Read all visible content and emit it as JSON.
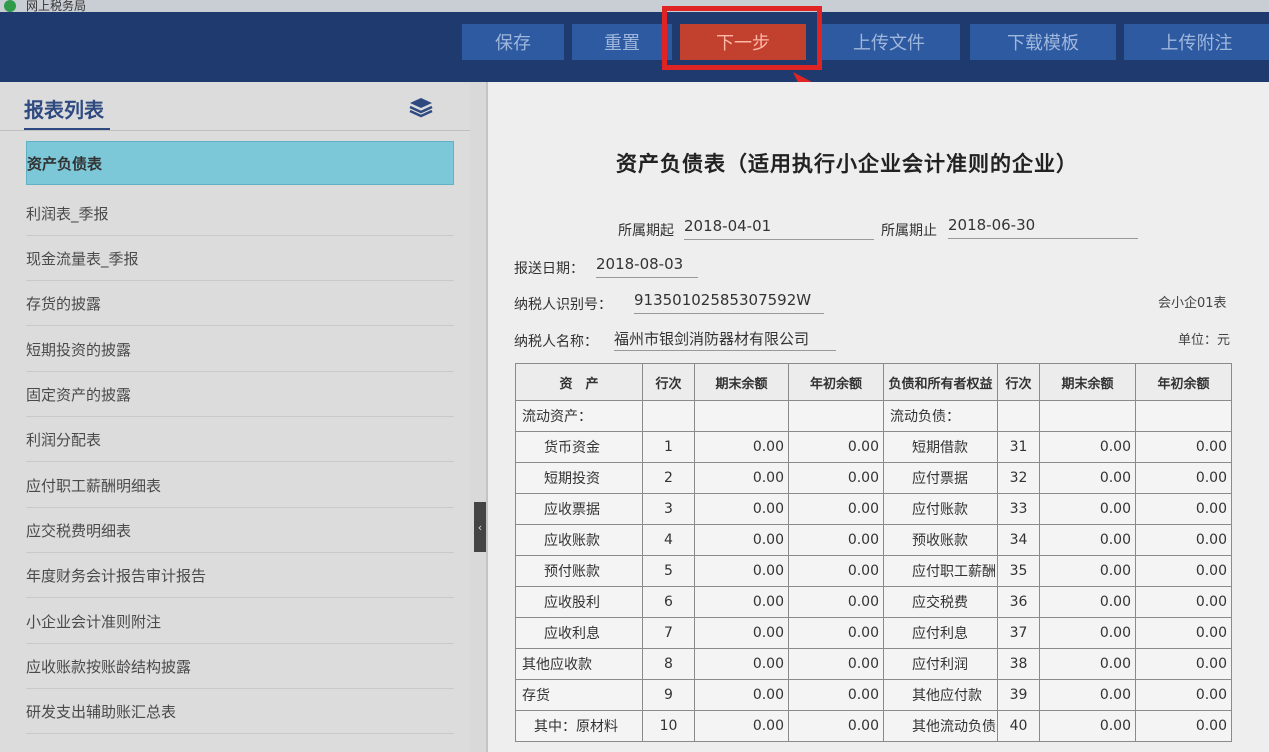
{
  "window": {
    "title": "网上税务局"
  },
  "toolbar": {
    "buttons": [
      {
        "label": "保存"
      },
      {
        "label": "重置"
      },
      {
        "label": "下一步"
      },
      {
        "label": "上传文件"
      },
      {
        "label": "下载模板"
      },
      {
        "label": "上传附注"
      }
    ]
  },
  "sidebar": {
    "title": "报表列表",
    "items": [
      {
        "label": "资产负债表"
      },
      {
        "label": "利润表_季报"
      },
      {
        "label": "现金流量表_季报"
      },
      {
        "label": "存货的披露"
      },
      {
        "label": "短期投资的披露"
      },
      {
        "label": "固定资产的披露"
      },
      {
        "label": "利润分配表"
      },
      {
        "label": "应付职工薪酬明细表"
      },
      {
        "label": "应交税费明细表"
      },
      {
        "label": "年度财务会计报告审计报告"
      },
      {
        "label": "小企业会计准则附注"
      },
      {
        "label": "应收账款按账龄结构披露"
      },
      {
        "label": "研发支出辅助账汇总表"
      }
    ]
  },
  "form": {
    "title": "资产负债表（适用执行小企业会计准则的企业）",
    "period_start_label": "所属期起",
    "period_start": "2018-04-01",
    "period_end_label": "所属期止",
    "period_end": "2018-06-30",
    "report_date_label": "报送日期：",
    "report_date": "2018-08-03",
    "taxpayer_id_label": "纳税人识别号：",
    "taxpayer_id": "91350102585307592W",
    "taxpayer_name_label": "纳税人名称：",
    "taxpayer_name": "福州市银剑消防器材有限公司",
    "form_code": "会小企01表",
    "unit": "单位：元"
  },
  "table": {
    "headers": {
      "asset": "资　产",
      "row_no": "行次",
      "end_balance": "期末余额",
      "begin_balance": "年初余额",
      "liability": "负债和所有者权益",
      "row_no_2": "行次",
      "end_balance_2": "期末余额",
      "begin_balance_2": "年初余额"
    },
    "section_left": "流动资产：",
    "section_right": "流动负债：",
    "rows": [
      {
        "asset": "货币资金",
        "no": "1",
        "end": "0.00",
        "begin": "0.00",
        "liab": "短期借款",
        "no2": "31",
        "end2": "0.00",
        "begin2": "0.00"
      },
      {
        "asset": "短期投资",
        "no": "2",
        "end": "0.00",
        "begin": "0.00",
        "liab": "应付票据",
        "no2": "32",
        "end2": "0.00",
        "begin2": "0.00"
      },
      {
        "asset": "应收票据",
        "no": "3",
        "end": "0.00",
        "begin": "0.00",
        "liab": "应付账款",
        "no2": "33",
        "end2": "0.00",
        "begin2": "0.00"
      },
      {
        "asset": "应收账款",
        "no": "4",
        "end": "0.00",
        "begin": "0.00",
        "liab": "预收账款",
        "no2": "34",
        "end2": "0.00",
        "begin2": "0.00"
      },
      {
        "asset": "预付账款",
        "no": "5",
        "end": "0.00",
        "begin": "0.00",
        "liab": "应付职工薪酬",
        "no2": "35",
        "end2": "0.00",
        "begin2": "0.00"
      },
      {
        "asset": "应收股利",
        "no": "6",
        "end": "0.00",
        "begin": "0.00",
        "liab": "应交税费",
        "no2": "36",
        "end2": "0.00",
        "begin2": "0.00"
      },
      {
        "asset": "应收利息",
        "no": "7",
        "end": "0.00",
        "begin": "0.00",
        "liab": "应付利息",
        "no2": "37",
        "end2": "0.00",
        "begin2": "0.00"
      },
      {
        "asset": "其他应收款",
        "no": "8",
        "end": "0.00",
        "begin": "0.00",
        "liab": "应付利润",
        "no2": "38",
        "end2": "0.00",
        "begin2": "0.00"
      },
      {
        "asset": "存货",
        "no": "9",
        "end": "0.00",
        "begin": "0.00",
        "liab": "其他应付款",
        "no2": "39",
        "end2": "0.00",
        "begin2": "0.00"
      },
      {
        "asset": "其中：原材料",
        "no": "10",
        "end": "0.00",
        "begin": "0.00",
        "liab": "其他流动负债",
        "no2": "40",
        "end2": "0.00",
        "begin2": "0.00"
      }
    ]
  },
  "colors": {
    "topbar": "#1f3a6e",
    "button": "#2d5aa0",
    "next_button": "#c2402e",
    "highlight": "#e02424",
    "sidebar_active": "#7cc8d8"
  }
}
